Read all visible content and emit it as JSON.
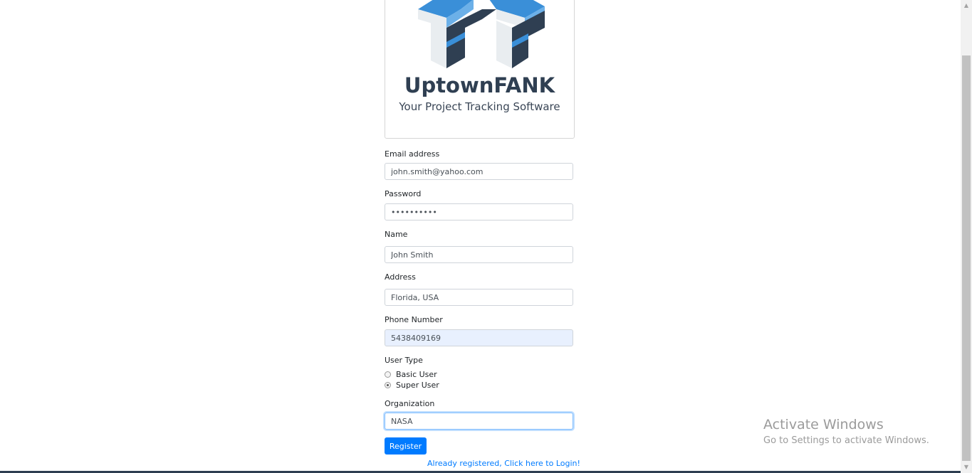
{
  "brand": {
    "name": "UptownFANK",
    "tagline": "Your Project Tracking Software",
    "colors": {
      "blue": "#3a8fd8",
      "light_blue": "#6cb0e8",
      "dark": "#2f3f52",
      "light": "#e9edf0"
    }
  },
  "form": {
    "email": {
      "label": "Email address",
      "value": "john.smith@yahoo.com"
    },
    "password": {
      "label": "Password",
      "value": "••••••••••"
    },
    "name": {
      "label": "Name",
      "value": "John Smith"
    },
    "address": {
      "label": "Address",
      "value": "Florida, USA"
    },
    "phone": {
      "label": "Phone Number",
      "value": "5438409169"
    },
    "user_type": {
      "label": "User Type",
      "options": [
        {
          "label": "Basic User",
          "checked": false
        },
        {
          "label": "Super User",
          "checked": true
        }
      ]
    },
    "organization": {
      "label": "Organization",
      "value": "NASA"
    },
    "register_label": "Register",
    "login_link": "Already registered, Click here to Login!"
  },
  "os_watermark": {
    "line1": "Activate Windows",
    "line2": "Go to Settings to activate Windows."
  },
  "colors": {
    "primary": "#007bff",
    "autofill_bg": "#e8f0fe",
    "focus_border": "#80bdff"
  }
}
